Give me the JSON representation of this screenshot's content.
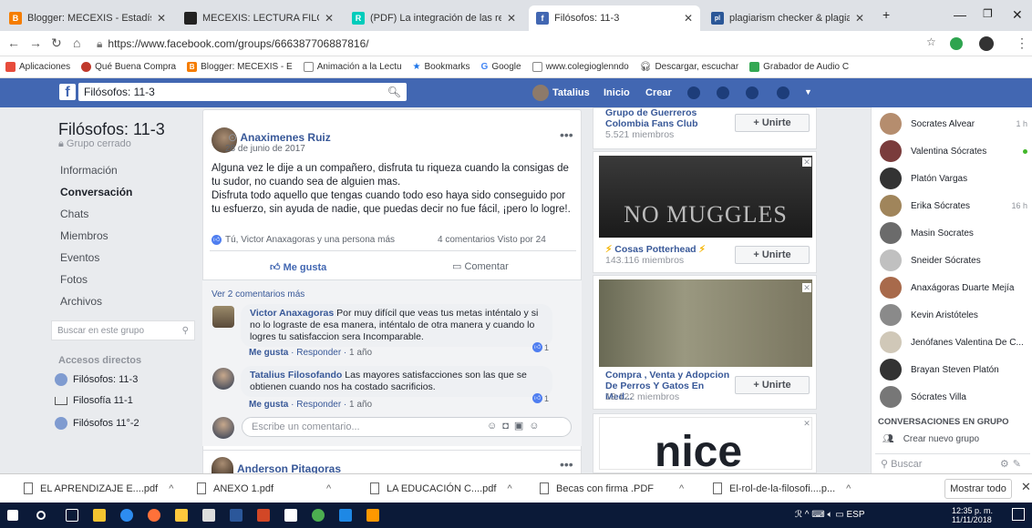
{
  "browser": {
    "tabs": [
      {
        "label": "Blogger: MECEXIS - Estadística",
        "color": "#f57d00",
        "glyph": "B"
      },
      {
        "label": "MECEXIS: LECTURA FILOSOFÍA",
        "color": "#222222",
        "glyph": ""
      },
      {
        "label": "(PDF) La integración de las red",
        "color": "#00ccbb",
        "glyph": "R"
      },
      {
        "label": "Filósofos: 11-3",
        "color": "#4267b2",
        "glyph": "f"
      },
      {
        "label": "plagiarism checker & plagiaris",
        "color": "#2b5797",
        "glyph": "pl"
      }
    ],
    "url": "https://www.facebook.com/groups/666387706887816/",
    "bookmarks": [
      {
        "label": "Aplicaciones",
        "color": "#e74c3c"
      },
      {
        "label": "Qué Buena Compra",
        "color": "#c0392b"
      },
      {
        "label": "Blogger: MECEXIS - E",
        "color": "#f57d00"
      },
      {
        "label": "Animación a la Lectu",
        "color": "#888888"
      },
      {
        "label": "Bookmarks",
        "color": "#1a73e8"
      },
      {
        "label": "Google",
        "color": "#4285f4"
      },
      {
        "label": "www.colegioglenndo",
        "color": "#888888"
      },
      {
        "label": "Descargar, escuchar",
        "color": "#888888"
      },
      {
        "label": "Grabador de Audio C",
        "color": "#34a853"
      }
    ]
  },
  "fb": {
    "search_value": "Filósofos: 11-3",
    "user": "Tatalius",
    "nav_inicio": "Inicio",
    "nav_crear": "Crear"
  },
  "group": {
    "title": "Filósofos: 11-3",
    "privacy": "Grupo cerrado",
    "menu": [
      "Información",
      "Conversación",
      "Chats",
      "Miembros",
      "Eventos",
      "Fotos",
      "Archivos"
    ],
    "search_placeholder": "Buscar en este grupo",
    "shortcuts_title": "Accesos directos",
    "shortcuts": [
      "Filósofos: 11-3",
      "Filosofía 11-1",
      "Filósofos 11°-2"
    ]
  },
  "post": {
    "author": "Anaximenes Ruiz",
    "date": "28 de junio de 2017",
    "text": "Alguna vez le dije a un compañero, disfruta tu riqueza cuando la consigas de tu sudor, no cuando sea de alguien mas.\nDisfruta todo aquello que tengas cuando todo eso haya sido conseguido por tu esfuerzo, sin ayuda de nadie, que puedas decir no fue fácil, ¡pero lo logre!.",
    "reactions": "Tú, Victor Anaxagoras y una persona más",
    "stats": "4 comentarios  Visto por 24",
    "like_label": "Me gusta",
    "comment_label": "Comentar",
    "more_comments": "Ver 2 comentarios más",
    "comments": [
      {
        "author": "Victor Anaxagoras",
        "text": "Por muy difícil que veas tus metas inténtalo y si no lo lograste de esa manera, inténtalo de otra manera y cuando lo logres tu satisfaccion sera Incomparable.",
        "like": "Me gusta",
        "reply": "Responder",
        "time": "1 año",
        "count": "1"
      },
      {
        "author": "Tatalius Filosofando",
        "text": "Las mayores satisfacciones son las que se obtienen cuando nos ha costado sacrificios.",
        "like": "Me gusta",
        "reply": "Responder",
        "time": "1 año",
        "count": "1"
      }
    ],
    "write_placeholder": "Escribe un comentario...",
    "next_author": "Anderson Pitagoras"
  },
  "suggestions": [
    {
      "name": "Grupo de Guerreros Colombia Fans Club",
      "members": "5.521 miembros",
      "button": "+ Unirte"
    },
    {
      "name": "Cosas Potterhead",
      "members": "143.116 miembros",
      "button": "+ Unirte",
      "image_text": "NO MUGGLES"
    },
    {
      "name": "Compra , Venta y Adopcion De Perros Y Gatos En Med...",
      "members": "13.122 miembros",
      "button": "+ Unirte"
    }
  ],
  "nice_text": "nice",
  "chat": {
    "contacts": [
      {
        "name": "Socrates Alvear",
        "time": "1 h",
        "color": "#b58d6e"
      },
      {
        "name": "Valentina Sócrates",
        "time": "",
        "color": "#7a3c3c",
        "online": true
      },
      {
        "name": "Platón Vargas",
        "time": "",
        "color": "#333333"
      },
      {
        "name": "Erika Sócrates",
        "time": "16 h",
        "color": "#a0855b"
      },
      {
        "name": "Masin Socrates",
        "time": "",
        "color": "#6b6b6b"
      },
      {
        "name": "Sneider Sócrates",
        "time": "",
        "color": "#c0c0c0"
      },
      {
        "name": "Anaxágoras Duarte Mejía",
        "time": "",
        "color": "#a86a4b"
      },
      {
        "name": "Kevin Aristóteles",
        "time": "",
        "color": "#8a8a8a"
      },
      {
        "name": "Jenófanes Valentina De C...",
        "time": "",
        "color": "#d0c8b8"
      },
      {
        "name": "Brayan Steven Platón",
        "time": "",
        "color": "#333333"
      },
      {
        "name": "Sócrates Villa",
        "time": "",
        "color": "#777777"
      }
    ],
    "group_conv_title": "CONVERSACIONES EN GRUPO",
    "create_group": "Crear nuevo grupo",
    "search_placeholder": "Buscar"
  },
  "downloads": {
    "items": [
      "EL APRENDIZAJE E....pdf",
      "ANEXO 1.pdf",
      "LA EDUCACIÓN C....pdf",
      "Becas con firma .PDF",
      "El-rol-de-la-filosofi....p..."
    ],
    "show_all": "Mostrar todo"
  },
  "taskbar": {
    "lang": "ESP",
    "time": "12:35 p. m.",
    "date": "11/11/2018"
  }
}
